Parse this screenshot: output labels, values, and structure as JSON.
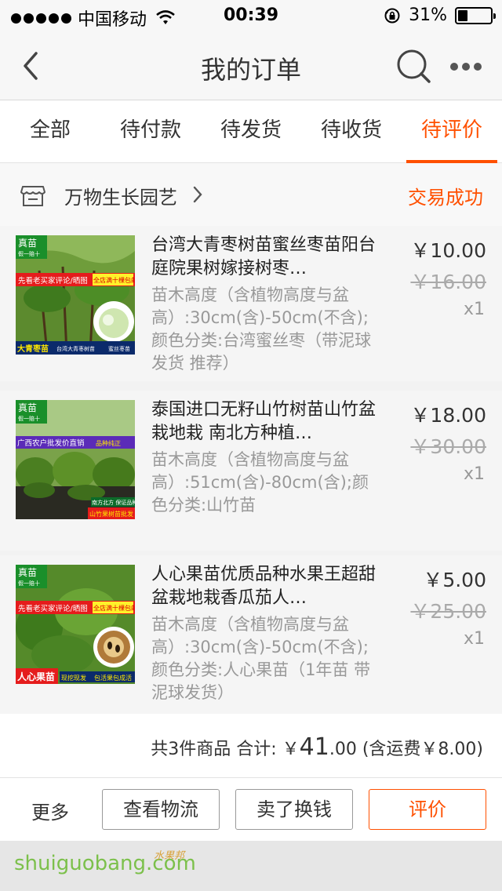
{
  "status_bar": {
    "carrier": "中国移动",
    "time": "00:39",
    "battery_percent": "31%",
    "battery_level": 0.31,
    "icons": [
      "signal-dots-icon",
      "wifi-icon",
      "rotation-lock-icon",
      "battery-icon"
    ]
  },
  "nav": {
    "title": "我的订单",
    "icons": [
      "back-arrow-icon",
      "search-icon",
      "more-icon"
    ]
  },
  "tabs": [
    {
      "label": "全部",
      "active": false
    },
    {
      "label": "待付款",
      "active": false
    },
    {
      "label": "待发货",
      "active": false
    },
    {
      "label": "待收货",
      "active": false
    },
    {
      "label": "待评价",
      "active": true
    }
  ],
  "shop": {
    "name": "万物生长园艺",
    "status": "交易成功"
  },
  "items": [
    {
      "title": "台湾大青枣树苗蜜丝枣苗阳台庭院果树嫁接树枣…",
      "sku": "苗木高度（含植物高度与盆高）:30cm(含)-50cm(不含);颜色分类:台湾蜜丝枣（带泥球发货 推荐）",
      "price": "￥10.00",
      "original_price": "￥16.00",
      "qty": "x1",
      "thumb": {
        "badge": "真苗",
        "badge_sub": "假一赔十",
        "banner": "先看老买家评论/晒图",
        "banner2": "全店满十棵包邮",
        "bottom_big": "大青枣苗",
        "bottom_small": "台湾大青枣树苗",
        "bottom_small2": "蜜丝枣苗"
      }
    },
    {
      "title": "泰国进口无籽山竹树苗山竹盆栽地栽 南北方种植…",
      "sku": "苗木高度（含植物高度与盆高）:51cm(含)-80cm(含);颜色分类:山竹苗",
      "price": "￥18.00",
      "original_price": "￥30.00",
      "qty": "x1",
      "thumb": {
        "badge": "真苗",
        "badge_sub": "假一赔十",
        "banner": "广西农户批发价直销",
        "banner2": "品种纯正",
        "bottom_big": "山竹果树苗批发",
        "bottom_small": "南方北方 保证品种"
      }
    },
    {
      "title": "人心果苗优质品种水果王超甜盆栽地栽香瓜茄人…",
      "sku": "苗木高度（含植物高度与盆高）:30cm(含)-50cm(不含);颜色分类:人心果苗（1年苗 带泥球发货）",
      "price": "￥5.00",
      "original_price": "￥25.00",
      "qty": "x1",
      "thumb": {
        "badge": "真苗",
        "badge_sub": "假一赔十",
        "banner": "先看老买家评论/晒图",
        "banner2": "全店满十棵包邮",
        "bottom_big": "人心果苗",
        "bottom_small": "现挖现发",
        "bottom_small2": "包活果包成活"
      }
    }
  ],
  "summary": {
    "prefix": "共3件商品 合计: ￥",
    "total_int": "41",
    "total_dec": ".00",
    "shipping": " (含运费￥8.00)"
  },
  "actions": {
    "more": "更多",
    "logistics": "查看物流",
    "resell": "卖了换钱",
    "review": "评价"
  },
  "watermark": {
    "text": "shuiguobang.com",
    "text_cn": "水果邦"
  }
}
